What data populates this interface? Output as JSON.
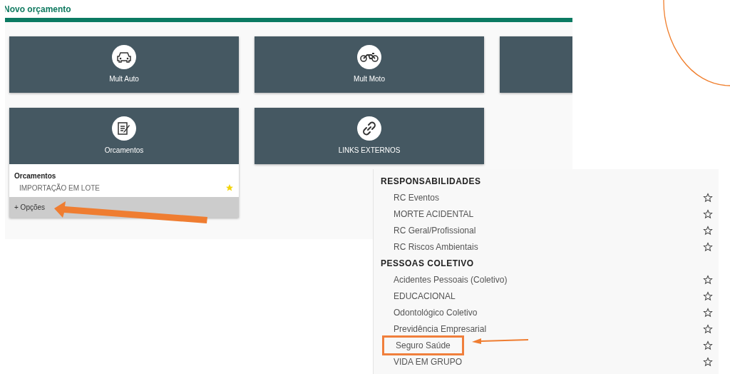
{
  "page_title": "Novo orçamento",
  "tiles": [
    {
      "kind": "car",
      "label": "Mult Auto"
    },
    {
      "kind": "moto",
      "label": "Mult Moto"
    },
    {
      "kind": "blank"
    },
    {
      "kind": "doc",
      "label": "Orcamentos",
      "expanded": true,
      "section": "Orcamentos",
      "items": [
        {
          "label": "IMPORTAÇÃO EM LOTE",
          "favorite": true
        }
      ],
      "options": "+ Opções"
    },
    {
      "kind": "link",
      "label": "LINKS EXTERNOS"
    }
  ],
  "menu": [
    {
      "heading": "RESPONSABILIDADES",
      "items": [
        {
          "label": "RC Eventos",
          "favorite": false,
          "highlighted": false
        },
        {
          "label": "MORTE ACIDENTAL",
          "favorite": false,
          "highlighted": false
        },
        {
          "label": "RC Geral/Profissional",
          "favorite": false,
          "highlighted": false
        },
        {
          "label": "RC Riscos Ambientais",
          "favorite": false,
          "highlighted": false
        }
      ]
    },
    {
      "heading": "PESSOAS COLETIVO",
      "items": [
        {
          "label": "Acidentes Pessoais (Coletivo)",
          "favorite": false,
          "highlighted": false
        },
        {
          "label": "EDUCACIONAL",
          "favorite": false,
          "highlighted": false
        },
        {
          "label": "Odontológico Coletivo",
          "favorite": false,
          "highlighted": false
        },
        {
          "label": "Previdência Empresarial",
          "favorite": false,
          "highlighted": false
        },
        {
          "label": "Seguro Saúde",
          "favorite": false,
          "highlighted": true
        },
        {
          "label": "VIDA EM GRUPO",
          "favorite": false,
          "highlighted": false
        }
      ]
    }
  ]
}
